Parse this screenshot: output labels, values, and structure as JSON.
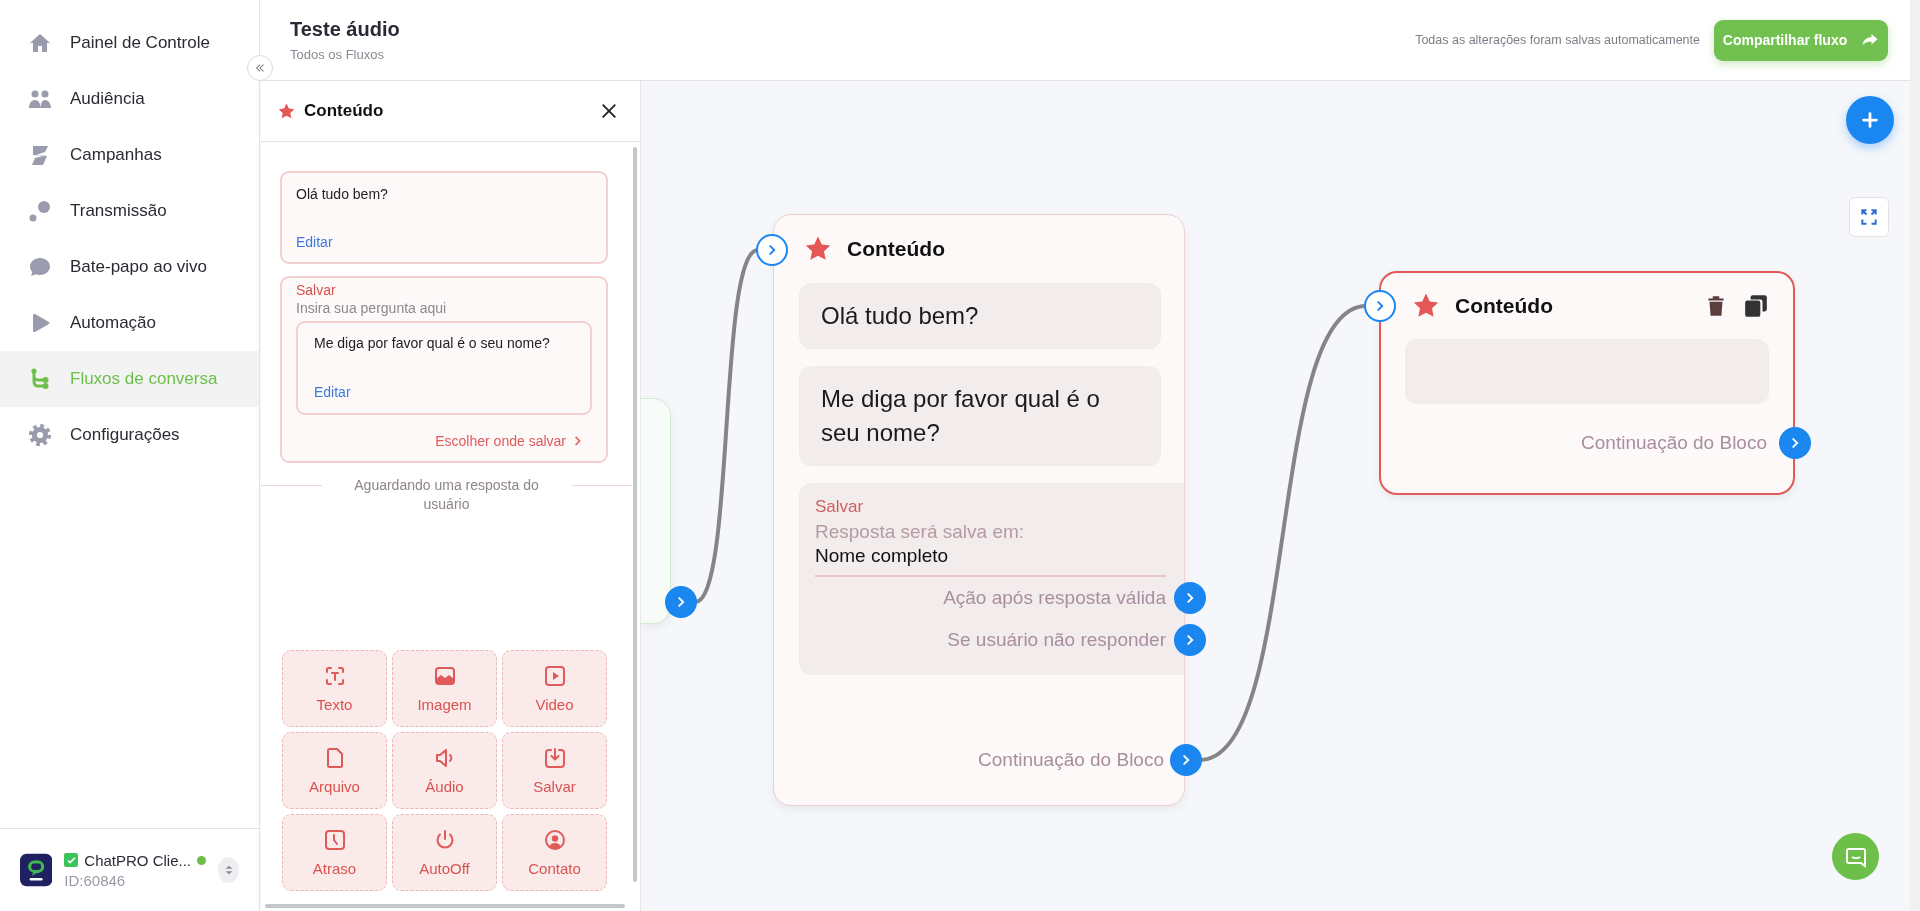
{
  "sidebar": {
    "items": [
      {
        "label": "Painel de Controle",
        "selected": false
      },
      {
        "label": "Audiência",
        "selected": false
      },
      {
        "label": "Campanhas",
        "selected": false
      },
      {
        "label": "Transmissão",
        "selected": false
      },
      {
        "label": "Bate-papo ao vivo",
        "selected": false
      },
      {
        "label": "Automação",
        "selected": false
      },
      {
        "label": "Fluxos de conversa",
        "selected": true
      },
      {
        "label": "Configurações",
        "selected": false
      }
    ],
    "account": {
      "name": "ChatPRO Clie...",
      "id": "ID:60846",
      "verified": true,
      "online": true
    }
  },
  "header": {
    "title": "Teste áudio",
    "breadcrumb": "Todos os Fluxos",
    "save_status": "Todas as alterações foram salvas automaticamente",
    "share_button": "Compartilhar fluxo"
  },
  "panel": {
    "title": "Conteúdo",
    "cards": [
      {
        "kind": "message",
        "text": "Olá tudo bem?",
        "edit_link": "Editar"
      },
      {
        "kind": "save",
        "label": "Salvar",
        "hint": "Insira sua pergunta aqui",
        "question": "Me diga por favor qual é o seu nome?",
        "edit_link": "Editar",
        "choose_link": "Escolher onde salvar"
      }
    ],
    "waiting_note": "Aguardando uma resposta do usuário",
    "tools": [
      {
        "label": "Texto"
      },
      {
        "label": "Imagem"
      },
      {
        "label": "Video"
      },
      {
        "label": "Arquivo"
      },
      {
        "label": "Áudio"
      },
      {
        "label": "Salvar"
      },
      {
        "label": "Atraso"
      },
      {
        "label": "AutoOff"
      },
      {
        "label": "Contato"
      }
    ]
  },
  "canvas": {
    "nodes": [
      {
        "kind": "covered",
        "selected": false,
        "continue_connected": true
      },
      {
        "kind": "content",
        "title": "Conteúdo",
        "selected": false,
        "continue_connected": true,
        "continue_label": "Continuação do Bloco",
        "items": [
          {
            "kind": "message",
            "text": "Olá tudo bem?"
          },
          {
            "kind": "message",
            "text": "Me diga por favor qual é o seu nome?"
          },
          {
            "kind": "save",
            "label": "Salvar",
            "caption": "Resposta será salva em:",
            "value": "Nome completo",
            "outputs": [
              "Ação após resposta válida",
              "Se usuário não responder"
            ]
          }
        ]
      },
      {
        "kind": "content",
        "title": "Conteúdo",
        "selected": true,
        "continue_label": "Continuação do Bloco",
        "items": [
          {
            "kind": "empty"
          }
        ]
      }
    ]
  }
}
